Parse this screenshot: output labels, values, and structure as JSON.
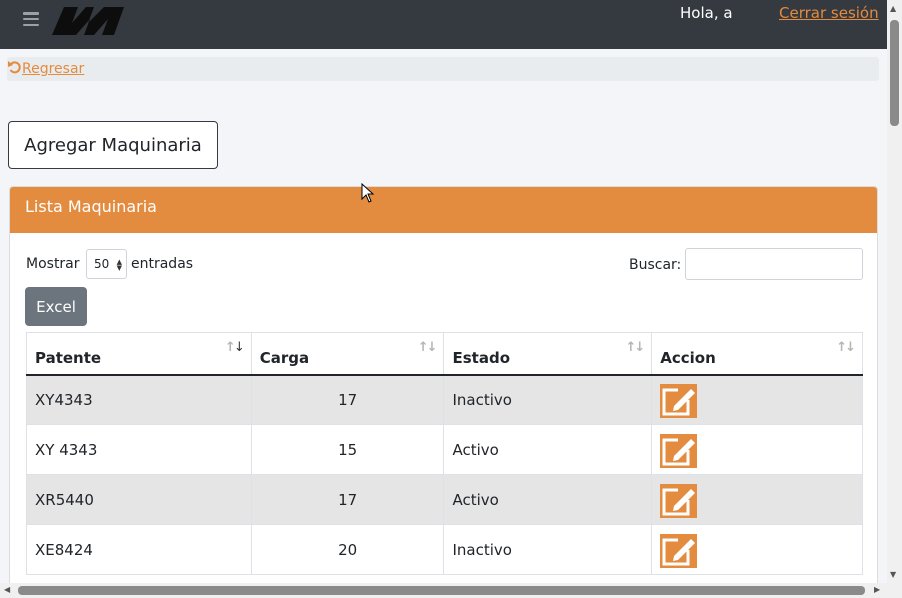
{
  "navbar": {
    "greeting": "Hola, a",
    "logout_label": "Cerrar sesión",
    "logo_icon": "brand-logo",
    "menu_icon": "hamburger-icon"
  },
  "back": {
    "label": "Regresar",
    "icon": "undo-icon"
  },
  "add_button": {
    "label": "Agregar Maquinaria"
  },
  "card": {
    "title": "Lista Maquinaria",
    "length": {
      "prefix": "Mostrar",
      "value": "50",
      "suffix": "entradas"
    },
    "search": {
      "label": "Buscar:",
      "value": ""
    },
    "excel_label": "Excel"
  },
  "table": {
    "headers": [
      "Patente",
      "Carga",
      "Estado",
      "Accion"
    ],
    "rows": [
      {
        "patente": "XY4343",
        "carga": "17",
        "estado": "Inactivo"
      },
      {
        "patente": "XY 4343",
        "carga": "15",
        "estado": "Activo"
      },
      {
        "patente": "XR5440",
        "carga": "17",
        "estado": "Activo"
      },
      {
        "patente": "XE8424",
        "carga": "20",
        "estado": "Inactivo"
      }
    ]
  },
  "colors": {
    "accent": "#e38b3f",
    "navbar": "#343a40",
    "excel_button": "#6c757d"
  }
}
